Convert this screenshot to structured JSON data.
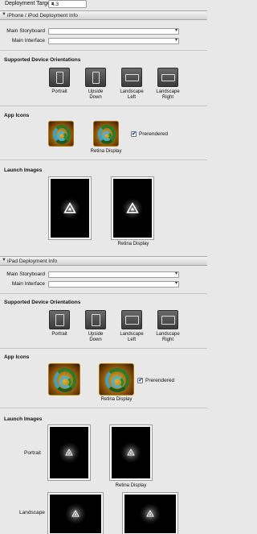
{
  "deployment": {
    "label": "Deployment Target",
    "value": "4.3"
  },
  "iphone": {
    "header": "iPhone / iPod Deployment Info",
    "main_storyboard_label": "Main Storyboard",
    "main_interface_label": "Main Interface",
    "orientations_title": "Supported Device Orientations",
    "orientations": [
      {
        "label1": "Portrait",
        "label2": "",
        "icon": "portrait-icon"
      },
      {
        "label1": "Upside",
        "label2": "Down",
        "icon": "upside-down-icon"
      },
      {
        "label1": "Landscape",
        "label2": "Left",
        "icon": "landscape-left-icon"
      },
      {
        "label1": "Landscape",
        "label2": "Right",
        "icon": "landscape-right-icon"
      }
    ],
    "app_icons_title": "App Icons",
    "retina_caption": "Retina Display",
    "prerendered_label": "Prerendered",
    "prerendered_checked": true,
    "launch_title": "Launch Images",
    "launch_retina_caption": "Retina Display"
  },
  "ipad": {
    "header": "iPad Deployment Info",
    "main_storyboard_label": "Main Storyboard",
    "main_interface_label": "Main Interface",
    "orientations_title": "Supported Device Orientations",
    "orientations": [
      {
        "label1": "Portrait",
        "label2": "",
        "icon": "portrait-icon"
      },
      {
        "label1": "Upside",
        "label2": "Down",
        "icon": "upside-down-icon"
      },
      {
        "label1": "Landscape",
        "label2": "Left",
        "icon": "landscape-left-icon"
      },
      {
        "label1": "Landscape",
        "label2": "Right",
        "icon": "landscape-right-icon"
      }
    ],
    "app_icons_title": "App Icons",
    "retina_caption": "Retina Display",
    "prerendered_label": "Prerendered",
    "prerendered_checked": true,
    "launch_title": "Launch Images",
    "portrait_label": "Portrait",
    "landscape_label": "Landscape",
    "launch_retina_caption": "Retina Display"
  },
  "colors": {
    "header_bg": "#dcdcdc",
    "panel_bg": "#e8e8e8",
    "check": "#1a4fb0"
  }
}
